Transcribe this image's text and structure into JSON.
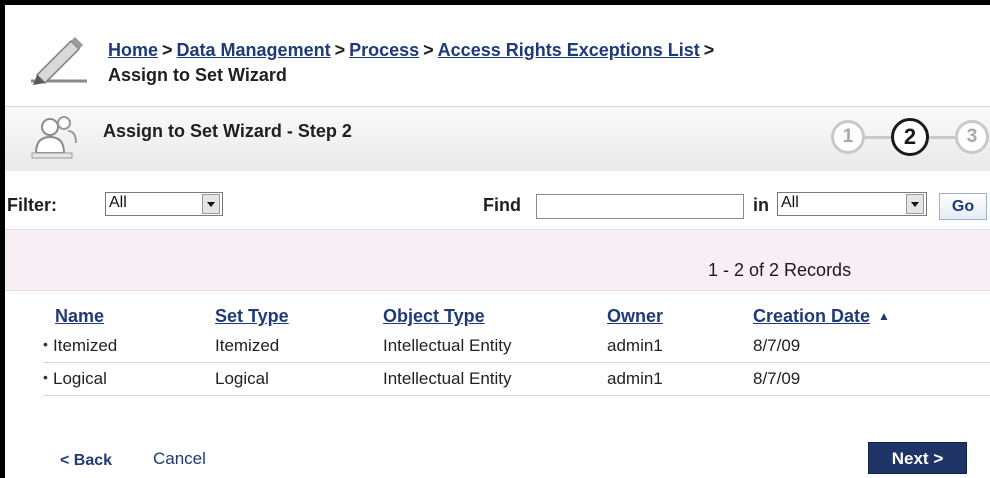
{
  "breadcrumb": {
    "items": [
      "Home",
      "Data Management",
      "Process",
      "Access Rights Exceptions List"
    ],
    "separator": ">",
    "current": "Assign to Set Wizard"
  },
  "wizard": {
    "title": "Assign to Set Wizard - Step 2",
    "steps": [
      "1",
      "2",
      "3"
    ],
    "active_step": "2"
  },
  "filter": {
    "label": "Filter:",
    "value": "All",
    "find_label": "Find",
    "find_value": "",
    "in_label": "in",
    "in_value": "All",
    "go_label": "Go"
  },
  "records": {
    "count_text": "1 - 2 of 2 Records"
  },
  "table": {
    "columns": [
      "Name",
      "Set Type",
      "Object Type",
      "Owner",
      "Creation Date"
    ],
    "sorted_column": "Creation Date",
    "rows": [
      [
        "Itemized",
        "Itemized",
        "Intellectual Entity",
        "admin1",
        "8/7/09"
      ],
      [
        "Logical",
        "Logical",
        "Intellectual Entity",
        "admin1",
        "8/7/09"
      ]
    ]
  },
  "footer": {
    "back_label": "< Back",
    "cancel_label": "Cancel",
    "next_label": "Next >"
  },
  "colors": {
    "link": "#1f3a78",
    "next_button": "#1e3466",
    "records_bar": "#f8eef6"
  }
}
